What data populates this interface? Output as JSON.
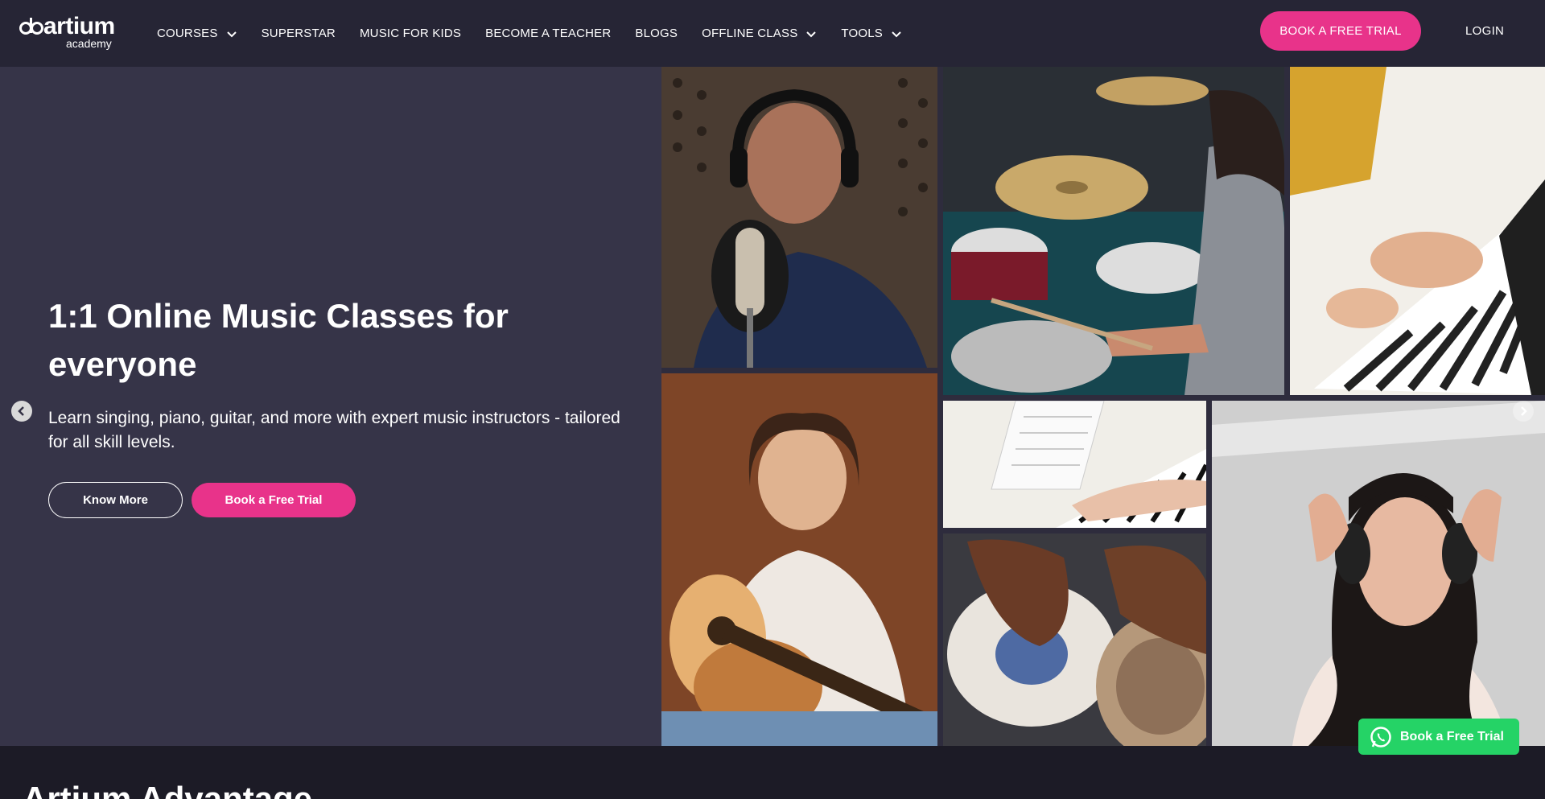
{
  "brand": {
    "name": "artium",
    "sub": "academy"
  },
  "nav": {
    "items": [
      {
        "label": "COURSES",
        "dropdown": true
      },
      {
        "label": "SUPERSTAR",
        "dropdown": false
      },
      {
        "label": "MUSIC FOR KIDS",
        "dropdown": false
      },
      {
        "label": "BECOME A TEACHER",
        "dropdown": false
      },
      {
        "label": "BLOGS",
        "dropdown": false
      },
      {
        "label": "OFFLINE CLASS",
        "dropdown": true
      },
      {
        "label": "TOOLS",
        "dropdown": true
      }
    ],
    "cta": "BOOK A FREE TRIAL",
    "login": "LOGIN"
  },
  "hero": {
    "title": "1:1 Online Music Classes for everyone",
    "subtitle": "Learn singing, piano, guitar, and more with expert music instructors - tailored for all skill levels.",
    "know_more": "Know More",
    "book_trial": "Book a Free Trial"
  },
  "gallery": [
    {
      "name": "singer-photo"
    },
    {
      "name": "drummer-photo"
    },
    {
      "name": "keyboard-photo"
    },
    {
      "name": "guitar-girl-photo"
    },
    {
      "name": "piano-hands-photo"
    },
    {
      "name": "tabla-photo"
    },
    {
      "name": "headphones-woman-photo"
    }
  ],
  "whatsapp": {
    "label": "Book a Free Trial",
    "icon": "whatsapp-icon",
    "color": "#25d366"
  },
  "section": {
    "title": "Artium Advantage"
  },
  "colors": {
    "accent": "#e8338a",
    "header_bg": "#262535",
    "hero_bg": "#363448"
  }
}
